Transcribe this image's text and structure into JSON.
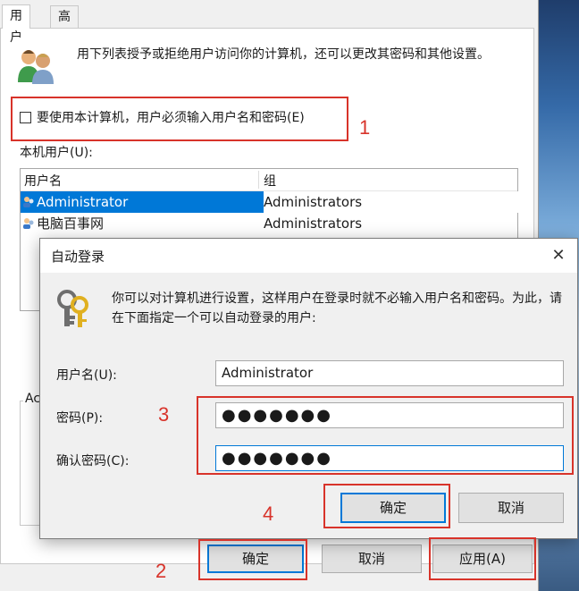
{
  "main_dialog": {
    "tabs": [
      {
        "label": "用户"
      },
      {
        "label": "高级"
      }
    ],
    "description": "用下列表授予或拒绝用户访问你的计算机，还可以更改其密码和其他设置。",
    "checkbox": {
      "label": "要使用本计算机，用户必须输入用户名和密码(E)",
      "checked": false
    },
    "users_list_label": "本机用户(U):",
    "columns": [
      "用户名",
      "组"
    ],
    "rows": [
      {
        "name": "Administrator",
        "group": "Administrators",
        "selected": true
      },
      {
        "name": "电脑百事网",
        "group": "Administrators",
        "selected": false
      }
    ],
    "group_fragment_label": "Ac",
    "buttons": {
      "ok": "确定",
      "cancel": "取消",
      "apply": "应用(A)"
    }
  },
  "autologon_dialog": {
    "title": "自动登录",
    "close_glyph": "✕",
    "description": "你可以对计算机进行设置，这样用户在登录时就不必输入用户名和密码。为此，请在下面指定一个可以自动登录的用户:",
    "fields": {
      "username": {
        "label": "用户名(U):",
        "value": "Administrator"
      },
      "password": {
        "label": "密码(P):",
        "value": "●●●●●●●"
      },
      "confirm": {
        "label": "确认密码(C):",
        "value": "●●●●●●●"
      }
    },
    "buttons": {
      "ok": "确定",
      "cancel": "取消"
    }
  },
  "annotations": {
    "n1": "1",
    "n2": "2",
    "n3": "3",
    "n4": "4",
    "color": "#d8332a"
  },
  "colors": {
    "accent": "#0078d7",
    "dialog_bg": "#f0f0f0"
  }
}
